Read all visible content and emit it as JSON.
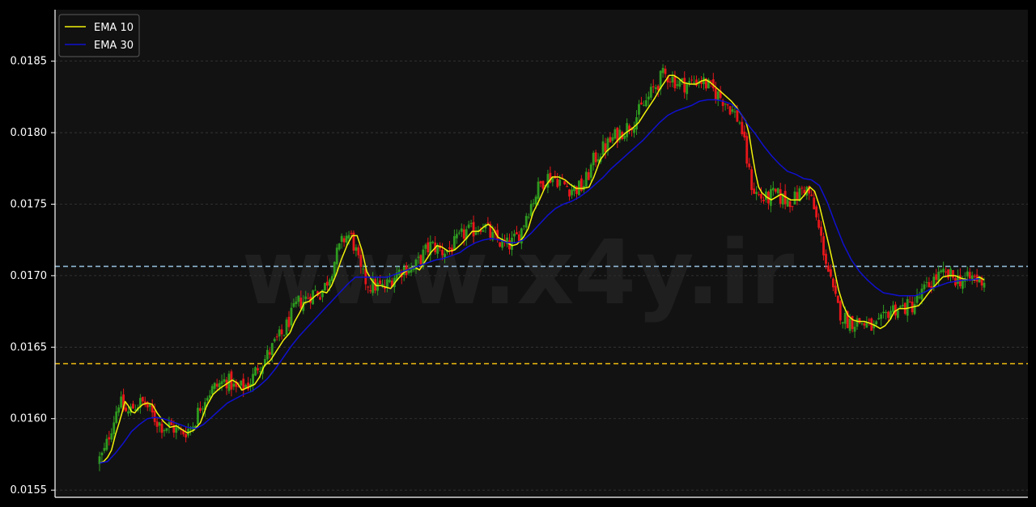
{
  "chart_data": {
    "type": "candlestick",
    "ylim": [
      0.01545,
      0.01886
    ],
    "yticks": [
      "0.0155",
      "0.0160",
      "0.0165",
      "0.0170",
      "0.0175",
      "0.0180",
      "0.0185"
    ],
    "grid": true,
    "legend_position": "top-left",
    "watermark": "www.x4y.ir",
    "colors": {
      "background": "#121212",
      "page": "#000000",
      "grid": "#3a3a3a",
      "axis": "#ffffff",
      "up": "#2e9a1f",
      "down": "#e8161a",
      "ema10": "#f2f20a",
      "ema30": "#1010d0",
      "level_upper": "#8fb8d6",
      "level_lower": "#e0b010"
    },
    "horizontal_levels": [
      {
        "value": 0.017065,
        "style": "dashed",
        "color_key": "level_upper"
      },
      {
        "value": 0.016385,
        "style": "dashed",
        "color_key": "level_lower"
      }
    ],
    "series": [
      {
        "name": "EMA 10",
        "color_key": "ema10",
        "points": [
          [
            0,
            0.01569
          ],
          [
            5,
            0.0157
          ],
          [
            10,
            0.01573
          ],
          [
            15,
            0.01578
          ],
          [
            20,
            0.01589
          ],
          [
            25,
            0.01598
          ],
          [
            28,
            0.01604
          ],
          [
            32,
            0.01612
          ],
          [
            36,
            0.01609
          ],
          [
            40,
            0.01605
          ],
          [
            44,
            0.01604
          ],
          [
            48,
            0.01607
          ],
          [
            54,
            0.0161
          ],
          [
            60,
            0.01611
          ],
          [
            66,
            0.0161
          ],
          [
            72,
            0.01604
          ],
          [
            80,
            0.01598
          ],
          [
            88,
            0.01594
          ],
          [
            96,
            0.01595
          ],
          [
            104,
            0.01592
          ],
          [
            110,
            0.0159
          ],
          [
            118,
            0.01592
          ],
          [
            126,
            0.01597
          ],
          [
            134,
            0.01609
          ],
          [
            142,
            0.01617
          ],
          [
            150,
            0.01621
          ],
          [
            158,
            0.01624
          ],
          [
            166,
            0.01627
          ],
          [
            172,
            0.01625
          ],
          [
            178,
            0.0162
          ],
          [
            186,
            0.01622
          ],
          [
            194,
            0.01624
          ],
          [
            200,
            0.01629
          ],
          [
            206,
            0.01637
          ],
          [
            214,
            0.01641
          ],
          [
            222,
            0.01648
          ],
          [
            230,
            0.01655
          ],
          [
            238,
            0.0166
          ],
          [
            244,
            0.01668
          ],
          [
            250,
            0.01674
          ],
          [
            256,
            0.01681
          ],
          [
            262,
            0.01682
          ],
          [
            270,
            0.01686
          ],
          [
            278,
            0.01689
          ],
          [
            284,
            0.01688
          ],
          [
            290,
            0.01693
          ],
          [
            296,
            0.01701
          ],
          [
            302,
            0.01711
          ],
          [
            310,
            0.01722
          ],
          [
            316,
            0.01728
          ],
          [
            322,
            0.01728
          ],
          [
            328,
            0.01718
          ],
          [
            334,
            0.01703
          ],
          [
            340,
            0.01697
          ],
          [
            346,
            0.01693
          ],
          [
            352,
            0.01693
          ],
          [
            358,
            0.01692
          ],
          [
            364,
            0.01691
          ],
          [
            372,
            0.01697
          ],
          [
            380,
            0.01702
          ],
          [
            388,
            0.01705
          ],
          [
            394,
            0.01706
          ],
          [
            400,
            0.01704
          ],
          [
            406,
            0.01709
          ],
          [
            414,
            0.01716
          ],
          [
            422,
            0.01721
          ],
          [
            428,
            0.0172
          ],
          [
            436,
            0.01717
          ],
          [
            444,
            0.01718
          ],
          [
            452,
            0.01722
          ],
          [
            460,
            0.01727
          ],
          [
            466,
            0.01731
          ],
          [
            474,
            0.01731
          ],
          [
            480,
            0.01734
          ],
          [
            486,
            0.01736
          ],
          [
            492,
            0.01733
          ],
          [
            498,
            0.01727
          ],
          [
            504,
            0.01725
          ],
          [
            510,
            0.01723
          ],
          [
            516,
            0.01721
          ],
          [
            522,
            0.01722
          ],
          [
            530,
            0.01727
          ],
          [
            536,
            0.01733
          ],
          [
            542,
            0.01744
          ],
          [
            550,
            0.01753
          ],
          [
            558,
            0.01763
          ],
          [
            566,
            0.01769
          ],
          [
            574,
            0.01769
          ],
          [
            582,
            0.01767
          ],
          [
            588,
            0.01764
          ],
          [
            596,
            0.01761
          ],
          [
            604,
            0.01761
          ],
          [
            612,
            0.01762
          ],
          [
            618,
            0.01769
          ],
          [
            626,
            0.01781
          ],
          [
            634,
            0.01787
          ],
          [
            642,
            0.01791
          ],
          [
            650,
            0.01796
          ],
          [
            658,
            0.018
          ],
          [
            666,
            0.01803
          ],
          [
            674,
            0.01807
          ],
          [
            682,
            0.01814
          ],
          [
            688,
            0.01819
          ],
          [
            694,
            0.01824
          ],
          [
            700,
            0.0183
          ],
          [
            706,
            0.01835
          ],
          [
            712,
            0.0184
          ],
          [
            718,
            0.0184
          ],
          [
            724,
            0.01838
          ],
          [
            730,
            0.01835
          ],
          [
            738,
            0.01834
          ],
          [
            746,
            0.01834
          ],
          [
            752,
            0.01836
          ],
          [
            758,
            0.01837
          ],
          [
            764,
            0.01835
          ],
          [
            770,
            0.01832
          ],
          [
            776,
            0.01829
          ],
          [
            782,
            0.01826
          ],
          [
            790,
            0.01822
          ],
          [
            796,
            0.01818
          ],
          [
            802,
            0.01813
          ],
          [
            808,
            0.01808
          ],
          [
            812,
            0.01799
          ],
          [
            816,
            0.01785
          ],
          [
            820,
            0.01772
          ],
          [
            824,
            0.01762
          ],
          [
            828,
            0.01758
          ],
          [
            834,
            0.01755
          ],
          [
            840,
            0.01753
          ],
          [
            846,
            0.01755
          ],
          [
            852,
            0.01757
          ],
          [
            858,
            0.01755
          ],
          [
            864,
            0.01753
          ],
          [
            870,
            0.01753
          ],
          [
            876,
            0.01753
          ],
          [
            882,
            0.01757
          ],
          [
            888,
            0.01762
          ],
          [
            894,
            0.01759
          ],
          [
            900,
            0.01749
          ],
          [
            906,
            0.01735
          ],
          [
            912,
            0.01721
          ],
          [
            918,
            0.01706
          ],
          [
            924,
            0.0169
          ],
          [
            930,
            0.01679
          ],
          [
            936,
            0.01672
          ],
          [
            942,
            0.01669
          ],
          [
            948,
            0.01668
          ],
          [
            956,
            0.01668
          ],
          [
            962,
            0.01667
          ],
          [
            970,
            0.01665
          ],
          [
            976,
            0.01663
          ],
          [
            982,
            0.01665
          ],
          [
            988,
            0.01669
          ],
          [
            994,
            0.01675
          ],
          [
            1000,
            0.01677
          ],
          [
            1008,
            0.01677
          ],
          [
            1016,
            0.01678
          ],
          [
            1024,
            0.01679
          ],
          [
            1030,
            0.01683
          ],
          [
            1038,
            0.01689
          ],
          [
            1046,
            0.01694
          ],
          [
            1054,
            0.01699
          ],
          [
            1062,
            0.017
          ],
          [
            1070,
            0.017
          ],
          [
            1078,
            0.01698
          ],
          [
            1086,
            0.01697
          ],
          [
            1094,
            0.01697
          ],
          [
            1100,
            0.01699
          ],
          [
            1106,
            0.01697
          ]
        ]
      },
      {
        "name": "EMA 30",
        "color_key": "ema30",
        "points": [
          [
            0,
            0.01569
          ],
          [
            10,
            0.0157
          ],
          [
            20,
            0.01576
          ],
          [
            30,
            0.01583
          ],
          [
            40,
            0.01591
          ],
          [
            50,
            0.01596
          ],
          [
            60,
            0.016
          ],
          [
            70,
            0.01601
          ],
          [
            80,
            0.016
          ],
          [
            90,
            0.01598
          ],
          [
            100,
            0.01596
          ],
          [
            110,
            0.01594
          ],
          [
            120,
            0.01593
          ],
          [
            130,
            0.01596
          ],
          [
            140,
            0.01601
          ],
          [
            150,
            0.01606
          ],
          [
            160,
            0.01611
          ],
          [
            170,
            0.01614
          ],
          [
            180,
            0.01617
          ],
          [
            190,
            0.01619
          ],
          [
            200,
            0.01623
          ],
          [
            210,
            0.01628
          ],
          [
            220,
            0.01635
          ],
          [
            230,
            0.01643
          ],
          [
            240,
            0.01651
          ],
          [
            250,
            0.01658
          ],
          [
            260,
            0.01664
          ],
          [
            270,
            0.0167
          ],
          [
            280,
            0.01676
          ],
          [
            290,
            0.01682
          ],
          [
            300,
            0.01688
          ],
          [
            310,
            0.01694
          ],
          [
            320,
            0.01699
          ],
          [
            330,
            0.01699
          ],
          [
            340,
            0.01699
          ],
          [
            350,
            0.01699
          ],
          [
            360,
            0.01699
          ],
          [
            370,
            0.01701
          ],
          [
            380,
            0.01703
          ],
          [
            390,
            0.01705
          ],
          [
            400,
            0.01707
          ],
          [
            410,
            0.01709
          ],
          [
            420,
            0.01711
          ],
          [
            430,
            0.01712
          ],
          [
            440,
            0.01714
          ],
          [
            450,
            0.01716
          ],
          [
            460,
            0.0172
          ],
          [
            470,
            0.01723
          ],
          [
            480,
            0.01725
          ],
          [
            490,
            0.01726
          ],
          [
            500,
            0.01725
          ],
          [
            510,
            0.01723
          ],
          [
            520,
            0.01723
          ],
          [
            530,
            0.01725
          ],
          [
            540,
            0.0173
          ],
          [
            550,
            0.01736
          ],
          [
            560,
            0.01742
          ],
          [
            570,
            0.01747
          ],
          [
            580,
            0.0175
          ],
          [
            590,
            0.01752
          ],
          [
            600,
            0.01755
          ],
          [
            610,
            0.01759
          ],
          [
            620,
            0.01764
          ],
          [
            630,
            0.01769
          ],
          [
            640,
            0.01775
          ],
          [
            650,
            0.0178
          ],
          [
            660,
            0.01785
          ],
          [
            670,
            0.0179
          ],
          [
            680,
            0.01795
          ],
          [
            690,
            0.01801
          ],
          [
            700,
            0.01807
          ],
          [
            710,
            0.01812
          ],
          [
            720,
            0.01815
          ],
          [
            730,
            0.01817
          ],
          [
            740,
            0.01819
          ],
          [
            750,
            0.01822
          ],
          [
            760,
            0.01823
          ],
          [
            770,
            0.01823
          ],
          [
            780,
            0.01822
          ],
          [
            790,
            0.0182
          ],
          [
            800,
            0.01815
          ],
          [
            810,
            0.01806
          ],
          [
            820,
            0.01799
          ],
          [
            830,
            0.01791
          ],
          [
            840,
            0.01784
          ],
          [
            850,
            0.01778
          ],
          [
            860,
            0.01773
          ],
          [
            870,
            0.01771
          ],
          [
            880,
            0.01768
          ],
          [
            890,
            0.01767
          ],
          [
            900,
            0.01763
          ],
          [
            910,
            0.01751
          ],
          [
            920,
            0.01736
          ],
          [
            930,
            0.01722
          ],
          [
            940,
            0.01711
          ],
          [
            950,
            0.01703
          ],
          [
            960,
            0.01697
          ],
          [
            970,
            0.01692
          ],
          [
            980,
            0.01688
          ],
          [
            990,
            0.01687
          ],
          [
            1000,
            0.01686
          ],
          [
            1010,
            0.01686
          ],
          [
            1020,
            0.01686
          ],
          [
            1030,
            0.01688
          ],
          [
            1040,
            0.01691
          ],
          [
            1050,
            0.01693
          ],
          [
            1060,
            0.01695
          ],
          [
            1070,
            0.01696
          ],
          [
            1080,
            0.01697
          ],
          [
            1090,
            0.01697
          ],
          [
            1100,
            0.01698
          ]
        ]
      }
    ],
    "candle_count": 370
  }
}
